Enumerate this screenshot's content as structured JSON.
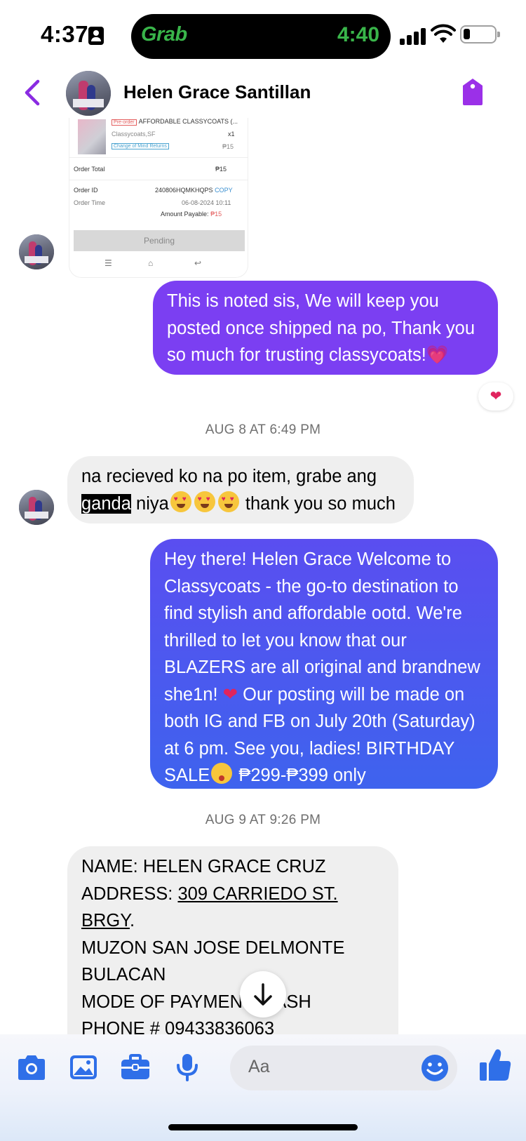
{
  "status_bar": {
    "time": "4:37",
    "island_app": "Grab",
    "island_timer": "4:40"
  },
  "header": {
    "contact_name": "Helen Grace Santillan"
  },
  "order_screenshot": {
    "preorder_badge": "Pre-order",
    "product_title": "AFFORDABLE CLASSYCOATS (...",
    "shop": "Classycoats,SF",
    "qty": "x1",
    "returns_badge": "Change of Mind Returns",
    "item_price": "₱15",
    "order_total_label": "Order Total",
    "order_total_value": "₱15",
    "order_id_label": "Order ID",
    "order_id_value": "240806HQMKHQPS",
    "copy_label": "COPY",
    "order_time_label": "Order Time",
    "order_time_value": "06-08-2024 10:11",
    "amount_payable_label": "Amount Payable:",
    "amount_payable_value": "₱15",
    "status_button": "Pending"
  },
  "messages": {
    "outgoing_1": "This is noted sis, We will keep you posted once shipped na po, Thank you so much for trusting classycoats!",
    "reaction_1": "❤",
    "timestamp_1": "AUG 8 AT 6:49 PM",
    "incoming_1_pre": "na recieved ko na po item, grabe ang",
    "incoming_1_highlight": "ganda",
    "incoming_1_mid": "niya",
    "incoming_1_post": "thank you so much",
    "outgoing_2_part1": "Hey there! Helen Grace  Welcome to Classycoats - the go-to destination to find stylish and affordable ootd. We're thrilled to let you know that our BLAZERS are all original and brandnew she1n!",
    "outgoing_2_part2": "Our posting will be made on both IG and FB on July 20th (Saturday) at 6 pm. See you, ladies! BIRTHDAY SALE",
    "outgoing_2_part3": "₱299-₱399 only",
    "timestamp_2": "AUG 9 AT 9:26 PM",
    "incoming_2_line1": "NAME: HELEN GRACE CRUZ",
    "incoming_2_line2_label": "ADDRESS: ",
    "incoming_2_line2_link": "309 CARRIEDO ST. BRGY",
    "incoming_2_line2_end": ".",
    "incoming_2_line3": "MUZON SAN JOSE DELMONTE",
    "incoming_2_line4": "BULACAN",
    "incoming_2_line5": "MODE OF PAYMENT: CASH",
    "incoming_2_line6": "PHONE # 09433836063"
  },
  "composer": {
    "placeholder": "Aa"
  },
  "colors": {
    "accent": "#8a2be2",
    "bubble_purple": "#7b3ff2",
    "bubble_blue": "#3e63ee",
    "messenger_blue": "#2f6fe8"
  }
}
